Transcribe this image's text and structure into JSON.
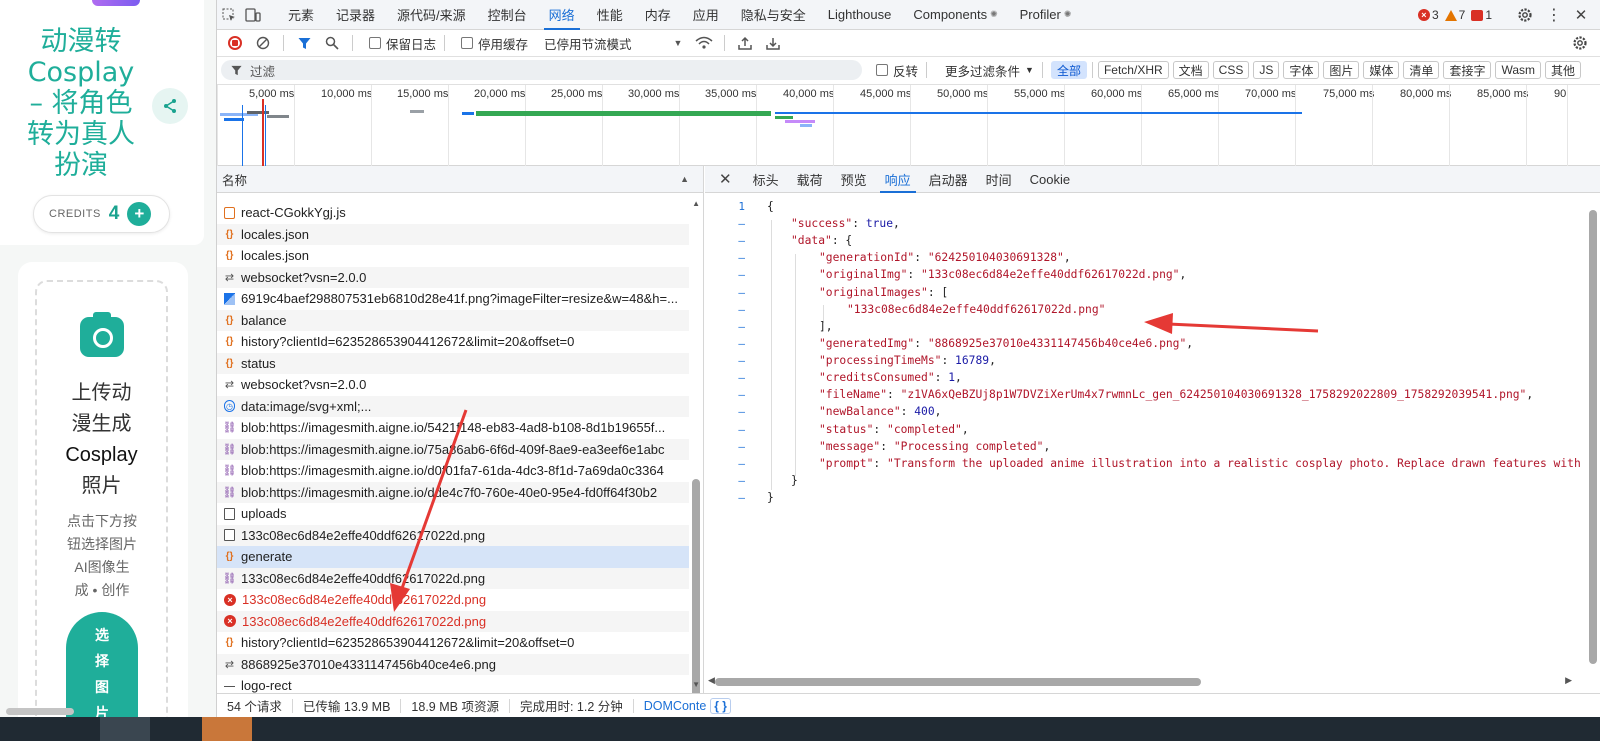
{
  "page": {
    "title": "动漫转 Cosplay – 将角色转为真人扮演",
    "title_lines": [
      "动漫转",
      "Cosplay",
      "– 将角色",
      "转为真人",
      "扮演"
    ],
    "credits_label": "CREDITS",
    "credits_value": "4",
    "upload_lines": [
      "上传动",
      "漫生成",
      "Cosplay",
      "照片"
    ],
    "hint_lines": [
      "点击下方按",
      "钮选择图片",
      "AI图像生",
      "成 • 创作"
    ],
    "pick_button_lines": [
      "选",
      "择",
      "图",
      "片"
    ]
  },
  "devtools": {
    "main_tabs": [
      "元素",
      "记录器",
      "源代码/来源",
      "控制台",
      "网络",
      "性能",
      "内存",
      "应用",
      "隐私与安全",
      "Lighthouse",
      "Components",
      "Profiler"
    ],
    "active_tab": "网络",
    "errors": "3",
    "warnings": "7",
    "issues": "1",
    "toolbar": {
      "preserve_log": "保留日志",
      "disable_cache": "停用缓存",
      "throttle": "已停用节流模式"
    },
    "filter": {
      "placeholder": "过滤",
      "invert": "反转",
      "more": "更多过滤条件",
      "types": [
        "全部",
        "Fetch/XHR",
        "文档",
        "CSS",
        "JS",
        "字体",
        "图片",
        "媒体",
        "清单",
        "套接字",
        "Wasm",
        "其他"
      ],
      "active_type": "全部"
    },
    "timeline_ticks": [
      "5,000 ms",
      "10,000 ms",
      "15,000 ms",
      "20,000 ms",
      "25,000 ms",
      "30,000 ms",
      "35,000 ms",
      "40,000 ms",
      "45,000 ms",
      "50,000 ms",
      "55,000 ms",
      "60,000 ms",
      "65,000 ms",
      "70,000 ms",
      "75,000 ms",
      "80,000 ms",
      "85,000 ms",
      "90"
    ],
    "request_list": {
      "header": "名称",
      "rows": [
        {
          "name": "react-CGokkYgj.js",
          "type": "js",
          "status": "ok"
        },
        {
          "name": "locales.json",
          "type": "json",
          "status": "ok"
        },
        {
          "name": "locales.json",
          "type": "json",
          "status": "ok"
        },
        {
          "name": "websocket?vsn=2.0.0",
          "type": "ws",
          "status": "ok"
        },
        {
          "name": "6919c4baef298807531eb6810d28e41f.png?imageFilter=resize&w=48&h=...",
          "type": "img",
          "status": "ok"
        },
        {
          "name": "balance",
          "type": "json",
          "status": "ok"
        },
        {
          "name": "history?clientId=623528653904412672&limit=20&offset=0",
          "type": "json",
          "status": "ok"
        },
        {
          "name": "status",
          "type": "json",
          "status": "ok"
        },
        {
          "name": "websocket?vsn=2.0.0",
          "type": "ws",
          "status": "ok"
        },
        {
          "name": "data:image/svg+xml;...",
          "type": "data",
          "status": "ok"
        },
        {
          "name": "blob:https://imagesmith.aigne.io/5421f148-eb83-4ad8-b108-8d1b19655f...",
          "type": "blob",
          "status": "ok"
        },
        {
          "name": "blob:https://imagesmith.aigne.io/75a86ab6-6f6d-409f-8ae9-ea3eef6e1abc",
          "type": "blob",
          "status": "ok"
        },
        {
          "name": "blob:https://imagesmith.aigne.io/d0f01fa7-61da-4dc3-8f1d-7a69da0c3364",
          "type": "blob",
          "status": "ok"
        },
        {
          "name": "blob:https://imagesmith.aigne.io/dde4c7f0-760e-40e0-95e4-fd0ff64f30b2",
          "type": "blob",
          "status": "ok"
        },
        {
          "name": "uploads",
          "type": "doc",
          "status": "ok"
        },
        {
          "name": "133c08ec6d84e2effe40ddf62617022d.png",
          "type": "doc",
          "status": "ok"
        },
        {
          "name": "generate",
          "type": "json",
          "status": "selected"
        },
        {
          "name": "133c08ec6d84e2effe40ddf62617022d.png",
          "type": "blob",
          "status": "ok"
        },
        {
          "name": "133c08ec6d84e2effe40ddf62617022d.png",
          "type": "err",
          "status": "error"
        },
        {
          "name": "133c08ec6d84e2effe40ddf62617022d.png",
          "type": "err",
          "status": "error"
        },
        {
          "name": "history?clientId=623528653904412672&limit=20&offset=0",
          "type": "json",
          "status": "ok"
        },
        {
          "name": "8868925e37010e4331147456b40ce4e6.png",
          "type": "ws",
          "status": "ok"
        },
        {
          "name": "logo-rect",
          "type": "dash",
          "status": "ok"
        }
      ]
    },
    "status_bar": {
      "requests": "54 个请求",
      "transferred": "已传输 13.9 MB",
      "resources": "18.9 MB 项资源",
      "finish": "完成用时: 1.2 分钟",
      "dom": "DOMConte"
    },
    "detail_tabs": [
      "标头",
      "载荷",
      "预览",
      "响应",
      "启动器",
      "时间",
      "Cookie"
    ],
    "active_detail_tab": "响应",
    "response": {
      "line_markers": [
        "1",
        "–",
        "–",
        "–",
        "–",
        "–",
        "–",
        "–",
        "–",
        "–",
        "–",
        "–",
        "–",
        "–",
        "–",
        "–",
        "–",
        "–"
      ],
      "success": "true",
      "generationId": "\"624250104030691328\"",
      "originalImg": "\"133c08ec6d84e2effe40ddf62617022d.png\"",
      "originalImages_0": "\"133c08ec6d84e2effe40ddf62617022d.png\"",
      "generatedImg": "\"8868925e37010e4331147456b40ce4e6.png\"",
      "processingTimeMs": "16789",
      "creditsConsumed": "1",
      "fileName": "\"z1VA6xQeBZUj8p1W7DVZiXerUm4x7rwmnLc_gen_624250104030691328_1758292022809_1758292039541.png\"",
      "newBalance": "400",
      "status": "\"completed\"",
      "message": "\"Processing completed\"",
      "prompt": "\"Transform the uploaded anime illustration into a realistic cosplay photo. Replace drawn features with"
    }
  },
  "colors": {
    "accent": "#1fae9a",
    "devtools_blue": "#1a6fd6",
    "error_red": "#d93025",
    "annotation_arrow": "#e53935"
  }
}
